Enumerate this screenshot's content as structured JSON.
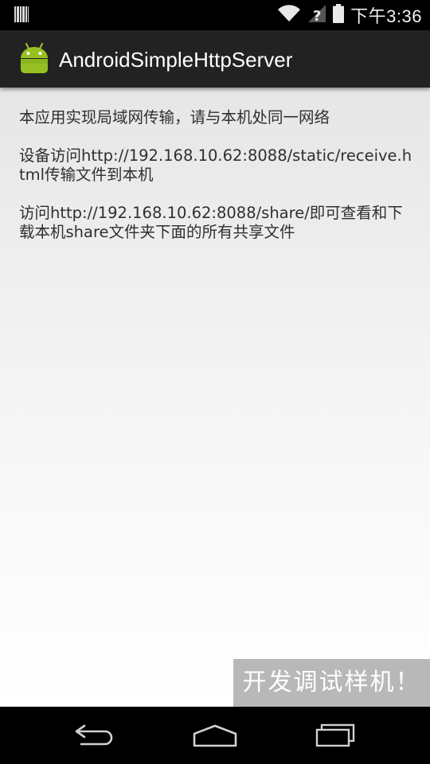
{
  "status_bar": {
    "time": "下午3:36",
    "icons": [
      "barcode-icon",
      "wifi-icon",
      "signal-no-sim-icon",
      "battery-icon"
    ]
  },
  "action_bar": {
    "title": "AndroidSimpleHttpServer",
    "icon": "android-robot-icon"
  },
  "content": {
    "paragraphs": [
      "本应用实现局域网传输，请与本机处同一网络",
      "设备访问http://192.168.10.62:8088/static/receive.html传输文件到本机",
      "访问http://192.168.10.62:8088/share/即可查看和下载本机share文件夹下面的所有共享文件"
    ]
  },
  "watermark": {
    "text": "开发调试样机！"
  },
  "nav_bar": {
    "buttons": [
      "back-icon",
      "home-icon",
      "recents-icon"
    ]
  },
  "colors": {
    "status_bar_bg": "#000000",
    "action_bar_bg": "#222222",
    "android_green": "#97C024",
    "content_text": "#2f2f2f",
    "watermark_bg": "#b8b8b8"
  }
}
